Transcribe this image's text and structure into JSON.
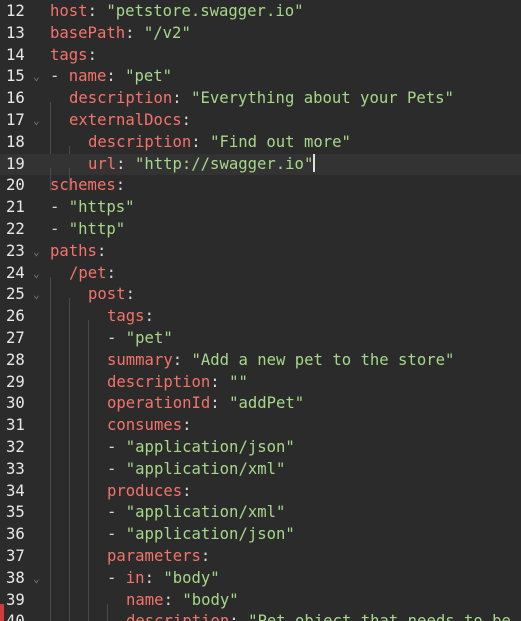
{
  "editor": {
    "colors": {
      "background": "#2b2b2b",
      "key": "#f4736b",
      "string": "#a6d88a",
      "plain": "#d8d8d8",
      "line_number": "#e8e8e8"
    },
    "lines": [
      {
        "n": "12",
        "indent": 0,
        "fold": false,
        "tokens": [
          {
            "t": "host",
            "c": "k"
          },
          {
            "t": ": ",
            "c": "p"
          },
          {
            "t": "\"petstore.swagger.io\"",
            "c": "s"
          }
        ]
      },
      {
        "n": "13",
        "indent": 0,
        "fold": false,
        "tokens": [
          {
            "t": "basePath",
            "c": "k"
          },
          {
            "t": ": ",
            "c": "p"
          },
          {
            "t": "\"/v2\"",
            "c": "s"
          }
        ]
      },
      {
        "n": "14",
        "indent": 0,
        "fold": false,
        "tokens": [
          {
            "t": "tags",
            "c": "k"
          },
          {
            "t": ":",
            "c": "p"
          }
        ]
      },
      {
        "n": "15",
        "indent": 0,
        "fold": true,
        "tokens": [
          {
            "t": "- ",
            "c": "p"
          },
          {
            "t": "name",
            "c": "k"
          },
          {
            "t": ": ",
            "c": "p"
          },
          {
            "t": "\"pet\"",
            "c": "s"
          }
        ]
      },
      {
        "n": "16",
        "indent": 1,
        "fold": false,
        "tokens": [
          {
            "t": "description",
            "c": "k"
          },
          {
            "t": ": ",
            "c": "p"
          },
          {
            "t": "\"Everything about your Pets\"",
            "c": "s"
          }
        ]
      },
      {
        "n": "17",
        "indent": 1,
        "fold": true,
        "tokens": [
          {
            "t": "externalDocs",
            "c": "k"
          },
          {
            "t": ":",
            "c": "p"
          }
        ]
      },
      {
        "n": "18",
        "indent": 2,
        "fold": false,
        "tokens": [
          {
            "t": "description",
            "c": "k"
          },
          {
            "t": ": ",
            "c": "p"
          },
          {
            "t": "\"Find out more\"",
            "c": "s"
          }
        ]
      },
      {
        "n": "19",
        "indent": 2,
        "fold": false,
        "active": true,
        "cursor": true,
        "tokens": [
          {
            "t": "url",
            "c": "k"
          },
          {
            "t": ": ",
            "c": "p"
          },
          {
            "t": "\"http://swagger.io\"",
            "c": "s"
          }
        ]
      },
      {
        "n": "20",
        "indent": 0,
        "fold": false,
        "tokens": [
          {
            "t": "schemes",
            "c": "k"
          },
          {
            "t": ":",
            "c": "p"
          }
        ]
      },
      {
        "n": "21",
        "indent": 0,
        "fold": false,
        "tokens": [
          {
            "t": "- ",
            "c": "p"
          },
          {
            "t": "\"https\"",
            "c": "s"
          }
        ]
      },
      {
        "n": "22",
        "indent": 0,
        "fold": false,
        "tokens": [
          {
            "t": "- ",
            "c": "p"
          },
          {
            "t": "\"http\"",
            "c": "s"
          }
        ]
      },
      {
        "n": "23",
        "indent": 0,
        "fold": true,
        "tokens": [
          {
            "t": "paths",
            "c": "k"
          },
          {
            "t": ":",
            "c": "p"
          }
        ]
      },
      {
        "n": "24",
        "indent": 1,
        "fold": true,
        "tokens": [
          {
            "t": "/pet",
            "c": "k"
          },
          {
            "t": ":",
            "c": "p"
          }
        ]
      },
      {
        "n": "25",
        "indent": 2,
        "fold": true,
        "tokens": [
          {
            "t": "post",
            "c": "k"
          },
          {
            "t": ":",
            "c": "p"
          }
        ]
      },
      {
        "n": "26",
        "indent": 3,
        "fold": false,
        "tokens": [
          {
            "t": "tags",
            "c": "k"
          },
          {
            "t": ":",
            "c": "p"
          }
        ]
      },
      {
        "n": "27",
        "indent": 3,
        "fold": false,
        "tokens": [
          {
            "t": "- ",
            "c": "p"
          },
          {
            "t": "\"pet\"",
            "c": "s"
          }
        ]
      },
      {
        "n": "28",
        "indent": 3,
        "fold": false,
        "tokens": [
          {
            "t": "summary",
            "c": "k"
          },
          {
            "t": ": ",
            "c": "p"
          },
          {
            "t": "\"Add a new pet to the store\"",
            "c": "s"
          }
        ]
      },
      {
        "n": "29",
        "indent": 3,
        "fold": false,
        "tokens": [
          {
            "t": "description",
            "c": "k"
          },
          {
            "t": ": ",
            "c": "p"
          },
          {
            "t": "\"\"",
            "c": "s"
          }
        ]
      },
      {
        "n": "30",
        "indent": 3,
        "fold": false,
        "tokens": [
          {
            "t": "operationId",
            "c": "k"
          },
          {
            "t": ": ",
            "c": "p"
          },
          {
            "t": "\"addPet\"",
            "c": "s"
          }
        ]
      },
      {
        "n": "31",
        "indent": 3,
        "fold": false,
        "tokens": [
          {
            "t": "consumes",
            "c": "k"
          },
          {
            "t": ":",
            "c": "p"
          }
        ]
      },
      {
        "n": "32",
        "indent": 3,
        "fold": false,
        "tokens": [
          {
            "t": "- ",
            "c": "p"
          },
          {
            "t": "\"application/json\"",
            "c": "s"
          }
        ]
      },
      {
        "n": "33",
        "indent": 3,
        "fold": false,
        "tokens": [
          {
            "t": "- ",
            "c": "p"
          },
          {
            "t": "\"application/xml\"",
            "c": "s"
          }
        ]
      },
      {
        "n": "34",
        "indent": 3,
        "fold": false,
        "tokens": [
          {
            "t": "produces",
            "c": "k"
          },
          {
            "t": ":",
            "c": "p"
          }
        ]
      },
      {
        "n": "35",
        "indent": 3,
        "fold": false,
        "tokens": [
          {
            "t": "- ",
            "c": "p"
          },
          {
            "t": "\"application/xml\"",
            "c": "s"
          }
        ]
      },
      {
        "n": "36",
        "indent": 3,
        "fold": false,
        "tokens": [
          {
            "t": "- ",
            "c": "p"
          },
          {
            "t": "\"application/json\"",
            "c": "s"
          }
        ]
      },
      {
        "n": "37",
        "indent": 3,
        "fold": false,
        "tokens": [
          {
            "t": "parameters",
            "c": "k"
          },
          {
            "t": ":",
            "c": "p"
          }
        ]
      },
      {
        "n": "38",
        "indent": 3,
        "fold": true,
        "tokens": [
          {
            "t": "- ",
            "c": "p"
          },
          {
            "t": "in",
            "c": "k"
          },
          {
            "t": ": ",
            "c": "p"
          },
          {
            "t": "\"body\"",
            "c": "s"
          }
        ]
      },
      {
        "n": "39",
        "indent": 4,
        "fold": false,
        "tokens": [
          {
            "t": "name",
            "c": "k"
          },
          {
            "t": ": ",
            "c": "p"
          },
          {
            "t": "\"body\"",
            "c": "s"
          }
        ]
      },
      {
        "n": "40",
        "indent": 4,
        "fold": false,
        "tokens": [
          {
            "t": "description",
            "c": "k"
          },
          {
            "t": ": ",
            "c": "p"
          },
          {
            "t": "\"Pet object that needs to be",
            "c": "s"
          }
        ]
      }
    ]
  }
}
